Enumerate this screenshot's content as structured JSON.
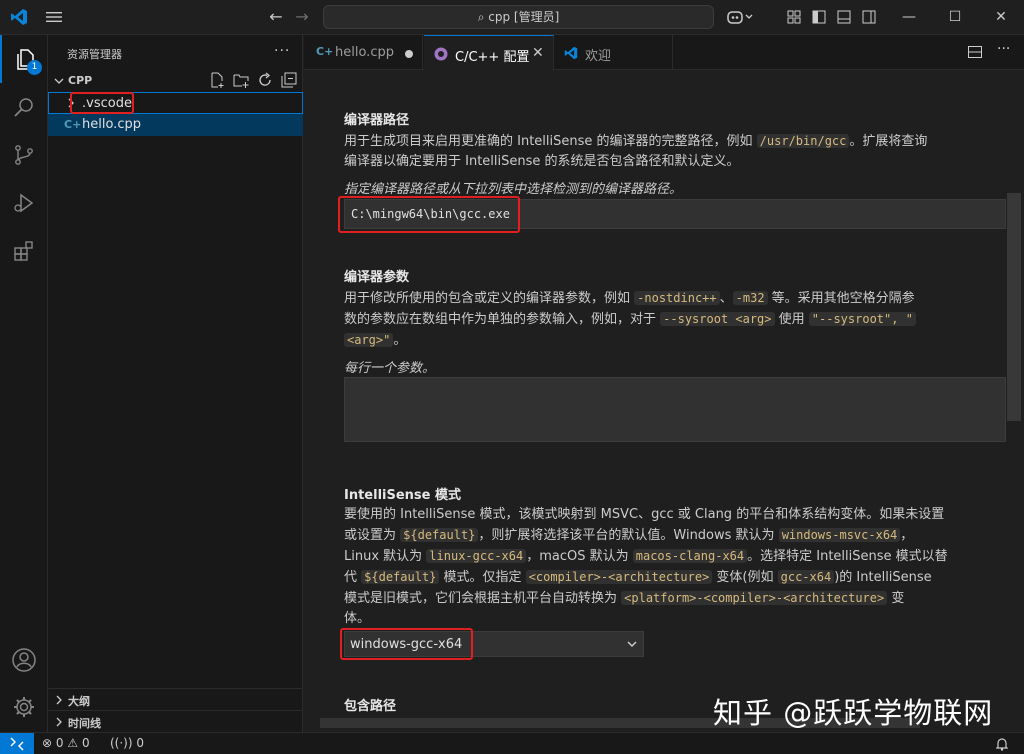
{
  "titlebar": {
    "search_text": "cpp [管理员]"
  },
  "activity": {
    "explorer_badge": "1"
  },
  "sidebar": {
    "title": "资源管理器",
    "more": "···",
    "section": "CPP",
    "items": [
      {
        "label": ".vscode"
      },
      {
        "label": "hello.cpp",
        "icon_text": "C+"
      }
    ],
    "outline": "大纲",
    "timeline": "时间线"
  },
  "tabs": [
    {
      "label": "hello.cpp"
    },
    {
      "label": "C/C++ 配置"
    },
    {
      "label": "欢迎"
    }
  ],
  "settings": {
    "compiler_path": {
      "title": "编译器路径",
      "desc_1": "用于生成项目来启用更准确的 IntelliSense 的编译器的完整路径，例如 ",
      "desc_code": "/usr/bin/gcc",
      "desc_2": "。扩展将查询",
      "desc_3": "编译器以确定要用于 IntelliSense 的系统是否包含路径和默认定义。",
      "hint": "指定编译器路径或从下拉列表中选择检测到的编译器路径。",
      "value": "C:\\mingw64\\bin\\gcc.exe"
    },
    "compiler_args": {
      "title": "编译器参数",
      "d1": "用于修改所使用的包含或定义的编译器参数，例如 ",
      "c1": "-nostdinc++",
      "d2": "、",
      "c2": "-m32",
      "d3": " 等。采用其他空格分隔参",
      "d4": "数的参数应在数组中作为单独的参数输入，例如，对于 ",
      "c3": "--sysroot <arg>",
      "d5": " 使用 ",
      "c4": "\"--sysroot\", \"",
      "c5": "<arg>\"",
      "d6": "。",
      "hint": "每行一个参数。"
    },
    "intellisense": {
      "title": "IntelliSense 模式",
      "l1": "要使用的 IntelliSense 模式，该模式映射到 MSVC、gcc 或 Clang 的平台和体系结构变体。如果未设置",
      "l2a": "或设置为 ",
      "l2c": "${default}",
      "l2b": "，则扩展将选择该平台的默认值。Windows 默认为 ",
      "l2d": "windows-msvc-x64",
      "l2e": "，",
      "l3a": "Linux 默认为 ",
      "l3c": "linux-gcc-x64",
      "l3b": "，macOS 默认为 ",
      "l3d": "macos-clang-x64",
      "l3e": "。选择特定 IntelliSense 模式以替",
      "l4a": "代 ",
      "l4c": "${default}",
      "l4b": " 模式。仅指定 ",
      "l4d": "<compiler>-<architecture>",
      "l4e": " 变体(例如 ",
      "l4f": "gcc-x64",
      "l4g": ")的 IntelliSense",
      "l5a": "模式是旧模式，它们会根据主机平台自动转换为 ",
      "l5c": "<platform>-<compiler>-<architecture>",
      "l5b": " 变",
      "l6": "体。",
      "value": "windows-gcc-x64"
    },
    "include_path": {
      "title": "包含路径"
    }
  },
  "statusbar": {
    "errors": "0",
    "warnings": "0",
    "ports": "0"
  },
  "watermark": "知乎 @跃跃学物联网"
}
